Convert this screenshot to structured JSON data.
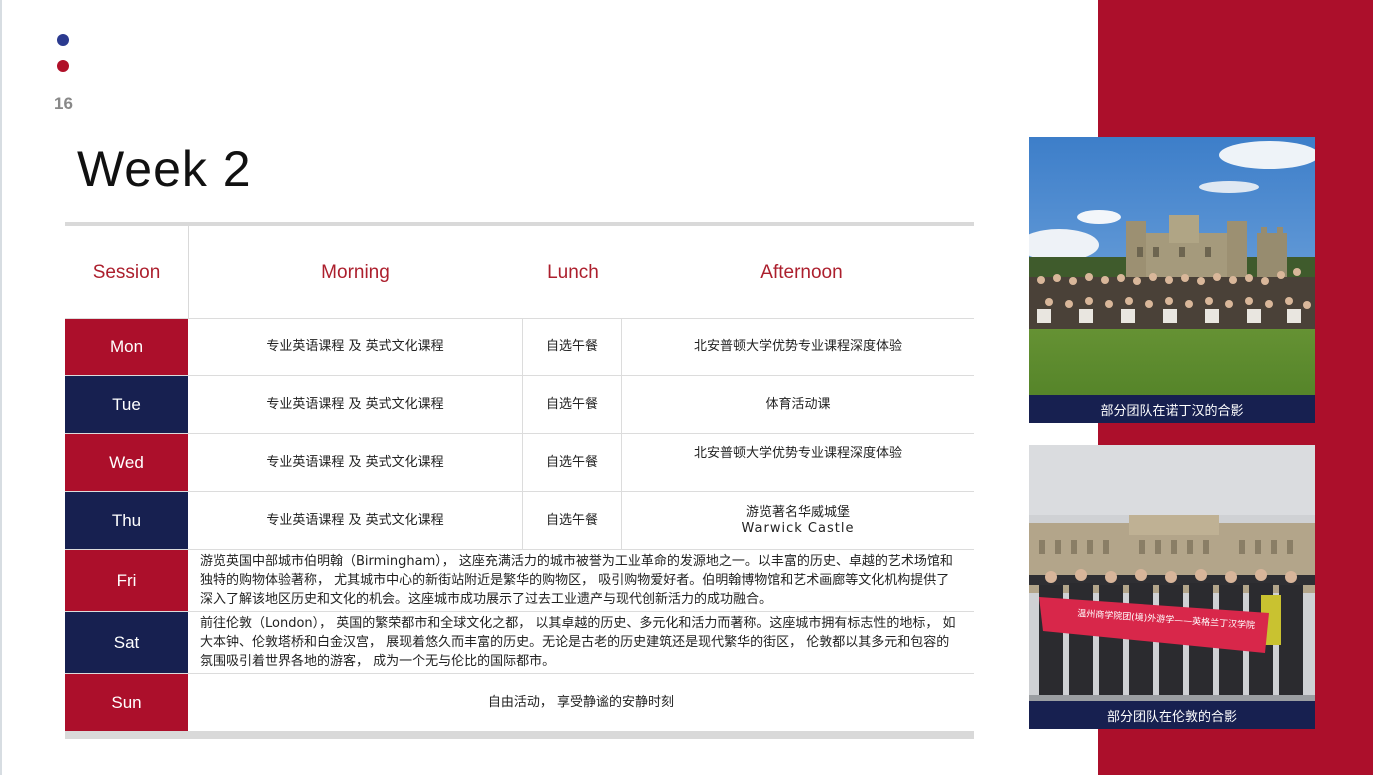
{
  "page": {
    "number": "16",
    "title": "Week 2"
  },
  "table": {
    "headers": {
      "session": "Session",
      "morning": "Morning",
      "lunch": "Lunch",
      "afternoon": "Afternoon"
    },
    "rows": [
      {
        "day": "Mon",
        "morning": "专业英语课程 及 英式文化课程",
        "lunch": "自选午餐",
        "afternoon": "北安普顿大学优势专业课程深度体验"
      },
      {
        "day": "Tue",
        "morning": "专业英语课程 及 英式文化课程",
        "lunch": "自选午餐",
        "afternoon": "体育活动课"
      },
      {
        "day": "Wed",
        "morning": "专业英语课程 及 英式文化课程",
        "lunch": "自选午餐",
        "afternoon": "北安普顿大学优势专业课程深度体验"
      },
      {
        "day": "Thu",
        "morning": "专业英语课程 及 英式文化课程",
        "lunch": "自选午餐",
        "afternoon_line1": "游览著名华威城堡",
        "afternoon_line2": "Warwick Castle"
      },
      {
        "day": "Fri",
        "full": "游览英国中部城市伯明翰（Birmingham）， 这座充满活力的城市被誉为工业革命的发源地之一。以丰富的历史、卓越的艺术场馆和独特的购物体验著称， 尤其城市中心的新街站附近是繁华的购物区， 吸引购物爱好者。伯明翰博物馆和艺术画廊等文化机构提供了深入了解该地区历史和文化的机会。这座城市成功展示了过去工业遗产与现代创新活力的成功融合。"
      },
      {
        "day": "Sat",
        "full": "前往伦敦（London）， 英国的繁荣都市和全球文化之都， 以其卓越的历史、多元化和活力而著称。这座城市拥有标志性的地标， 如大本钟、伦敦塔桥和白金汉宫， 展现着悠久而丰富的历史。无论是古老的历史建筑还是现代繁华的街区， 伦敦都以其多元和包容的氛围吸引着世界各地的游客， 成为一个无与伦比的国际都市。"
      },
      {
        "day": "Sun",
        "full": "自由活动， 享受静谧的安静时刻"
      }
    ]
  },
  "photos": {
    "photo1_caption": "部分团队在诺丁汉的合影",
    "photo2_caption": "部分团队在伦敦的合影",
    "banner_text": "温州商学院团(境)外游学——英格兰丁汉学院"
  },
  "colors": {
    "red": "#ac0f2b",
    "navy": "#172050",
    "header_text": "#ac1f2d"
  }
}
